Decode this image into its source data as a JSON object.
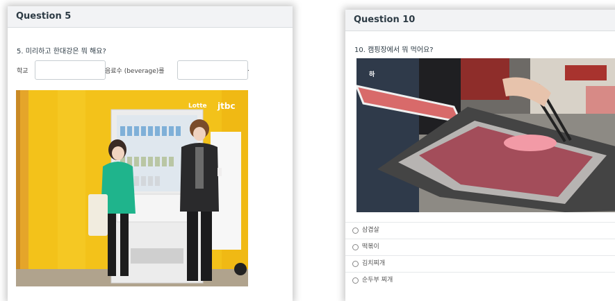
{
  "q5": {
    "header": "Question 5",
    "text": "5. 미리하고 한대강은 뭐 해요?",
    "label_school": "학교",
    "label_beverage": "음료수 (beverage)를",
    "period": ".",
    "blank1_value": "",
    "blank2_value": "",
    "image_logo": "jtbc"
  },
  "q10": {
    "header": "Question 10",
    "text": "10. 캠핑장에서 뭐 먹어요?",
    "answers": [
      "삼겹살",
      "떡볶이",
      "김치찌개",
      "순두부 찌개"
    ]
  }
}
